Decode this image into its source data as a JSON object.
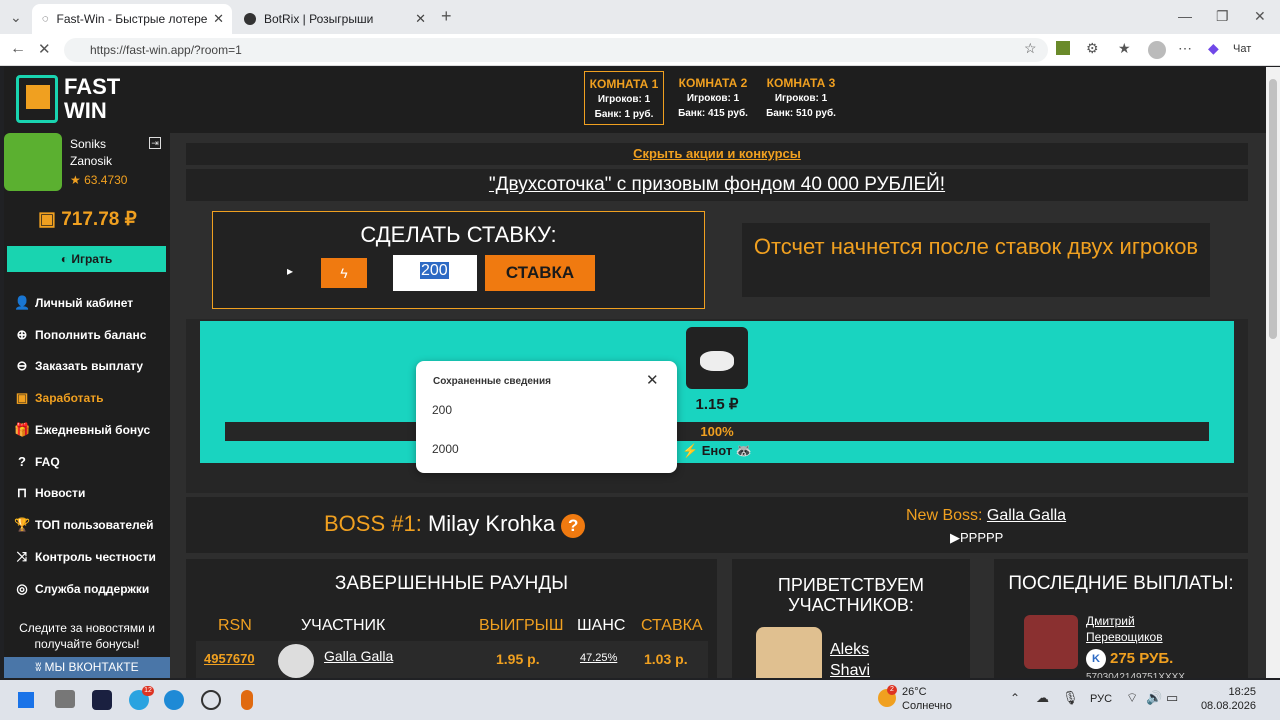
{
  "browser": {
    "tabs": [
      {
        "title": "Fast-Win - Быстрые лотереи! Ком"
      },
      {
        "title": "BotRix | Розыгрыши"
      }
    ],
    "url": "https://fast-win.app/?room=1",
    "copilot_label": "Чат"
  },
  "sidebar": {
    "logo_top": "FAST",
    "logo_bottom": "WIN",
    "user_first": "Soniks",
    "user_last": "Zanosik",
    "rating": "★ 63.4730",
    "balance": "717.78 ₽",
    "play_label": "Играть",
    "menu": [
      {
        "label": "Личный кабинет",
        "icon": "person-icon"
      },
      {
        "label": "Пополнить баланс",
        "icon": "plus-circle-icon"
      },
      {
        "label": "Заказать выплату",
        "icon": "arrow-down-circle-icon"
      },
      {
        "label": "Заработать",
        "icon": "money-icon"
      },
      {
        "label": "Ежедневный бонус",
        "icon": "gift-icon"
      },
      {
        "label": "FAQ",
        "icon": "question-icon"
      },
      {
        "label": "Новости",
        "icon": "bookmark-icon"
      },
      {
        "label": "ТОП пользователей",
        "icon": "trophy-icon"
      },
      {
        "label": "Контроль честности",
        "icon": "shuffle-icon"
      },
      {
        "label": "Служба поддержки",
        "icon": "support-icon"
      }
    ],
    "news_text": "Следите за новостями и получайте бонусы!",
    "vk_label": "МЫ ВКОНТАКТЕ"
  },
  "rooms": [
    {
      "name": "КОМНАТА 1",
      "players": "Игроков: 1",
      "bank": "Банк: 1 руб."
    },
    {
      "name": "КОМНАТА 2",
      "players": "Игроков: 1",
      "bank": "Банк: 415 руб."
    },
    {
      "name": "КОМНАТА 3",
      "players": "Игроков: 1",
      "bank": "Банк: 510 руб."
    }
  ],
  "promo": {
    "hide_label": "Скрыть акции и конкурсы",
    "banner": "\"Двухсоточка\" с призовым фондом 40 000 РУБЛЕЙ!"
  },
  "bet": {
    "title": "СДЕЛАТЬ СТАВКУ:",
    "value": "200",
    "button": "СТАВКА"
  },
  "autocomplete": {
    "header": "Сохраненные сведения",
    "items": [
      "200",
      "2000"
    ]
  },
  "countdown": "Отсчет начнется после ставок двух игроков",
  "game": {
    "player_amount": "1.15 ₽",
    "progress": "100%",
    "progress_value": 1.0,
    "player_name": "⚡ Енот 🦝"
  },
  "boss": {
    "label": "BOSS #1:",
    "name": "Milay Krohka",
    "new_label": "New Boss:",
    "new_name": "Galla Galla",
    "flags": "▶PPPPP"
  },
  "rounds": {
    "title": "ЗАВЕРШЕННЫЕ РАУНДЫ",
    "headers": [
      "RSN",
      "УЧАСТНИК",
      "ВЫИГРЫШ",
      "ШАНС",
      "СТАВКА"
    ],
    "rows": [
      {
        "rsn": "4957670",
        "user": "Galla Galla",
        "win": "1.95 р.",
        "chance": "47.25%",
        "bet": "1.03 р."
      }
    ]
  },
  "welcome": {
    "title": "ПРИВЕТСТВУЕМ УЧАСТНИКОВ:",
    "name": "Aleks Shavi"
  },
  "payouts": {
    "title": "ПОСЛЕДНИЕ ВЫПЛАТЫ:",
    "name": "Дмитрий Перевощиков",
    "amount": "275 РУБ.",
    "card": "5703042149751XXXX"
  },
  "taskbar": {
    "weather_temp": "26°C",
    "weather_text": "Солнечно",
    "lang": "РУС",
    "time": "18:25",
    "date": "08.08.2026",
    "tg_badge": "12",
    "weather_badge": "2"
  }
}
